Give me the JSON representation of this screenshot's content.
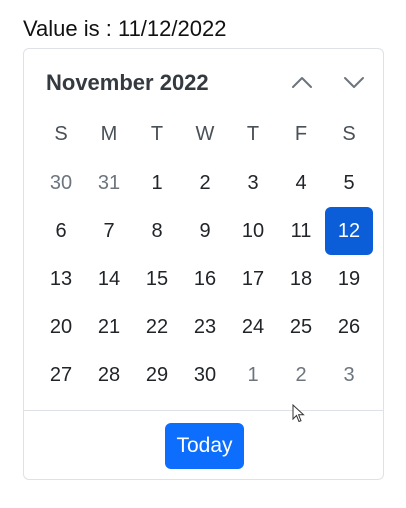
{
  "value_label": "Value is : 11/12/2022",
  "calendar": {
    "month_title": "November 2022",
    "nav": {
      "prev_icon": "chevron-up-icon",
      "next_icon": "chevron-down-icon"
    },
    "weekdays": [
      "S",
      "M",
      "T",
      "W",
      "T",
      "F",
      "S"
    ],
    "weeks": [
      [
        {
          "d": "30",
          "other": true
        },
        {
          "d": "31",
          "other": true
        },
        {
          "d": "1"
        },
        {
          "d": "2"
        },
        {
          "d": "3"
        },
        {
          "d": "4"
        },
        {
          "d": "5"
        }
      ],
      [
        {
          "d": "6"
        },
        {
          "d": "7"
        },
        {
          "d": "8"
        },
        {
          "d": "9"
        },
        {
          "d": "10"
        },
        {
          "d": "11"
        },
        {
          "d": "12",
          "selected": true
        }
      ],
      [
        {
          "d": "13"
        },
        {
          "d": "14"
        },
        {
          "d": "15"
        },
        {
          "d": "16"
        },
        {
          "d": "17"
        },
        {
          "d": "18"
        },
        {
          "d": "19"
        }
      ],
      [
        {
          "d": "20"
        },
        {
          "d": "21"
        },
        {
          "d": "22"
        },
        {
          "d": "23"
        },
        {
          "d": "24"
        },
        {
          "d": "25"
        },
        {
          "d": "26"
        }
      ],
      [
        {
          "d": "27"
        },
        {
          "d": "28"
        },
        {
          "d": "29"
        },
        {
          "d": "30"
        },
        {
          "d": "1",
          "other": true
        },
        {
          "d": "2",
          "other": true
        },
        {
          "d": "3",
          "other": true
        }
      ]
    ],
    "today_label": "Today"
  },
  "colors": {
    "selected_bg": "#0b5ed7",
    "today_button_bg": "#0d6efd",
    "other_month_text": "#6c757d"
  }
}
